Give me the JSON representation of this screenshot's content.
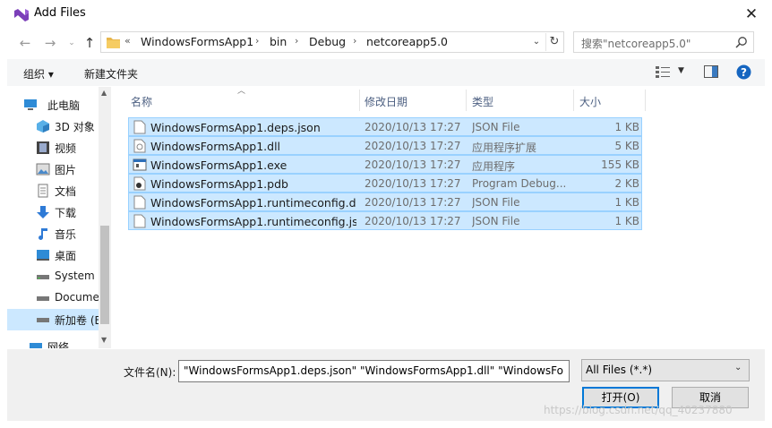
{
  "window": {
    "title": "Add Files"
  },
  "address": {
    "prefix": "«",
    "crumbs": [
      "WindowsFormsApp1",
      "bin",
      "Debug",
      "netcoreapp5.0"
    ]
  },
  "search": {
    "placeholder": "搜索\"netcoreapp5.0\""
  },
  "toolbar": {
    "organize_label": "组织 ▾",
    "new_folder_label": "新建文件夹"
  },
  "sidebar": {
    "items": [
      {
        "label": "此电脑",
        "icon": "computer-icon"
      },
      {
        "label": "3D 对象",
        "icon": "3d-objects-icon"
      },
      {
        "label": "视频",
        "icon": "video-icon"
      },
      {
        "label": "图片",
        "icon": "pictures-icon"
      },
      {
        "label": "文档",
        "icon": "documents-icon"
      },
      {
        "label": "下载",
        "icon": "download-icon"
      },
      {
        "label": "音乐",
        "icon": "music-icon"
      },
      {
        "label": "桌面",
        "icon": "desktop-icon"
      },
      {
        "label": "System (",
        "icon": "drive-icon"
      },
      {
        "label": "Docume",
        "icon": "drive-icon"
      },
      {
        "label": "新加卷 (E",
        "icon": "drive-icon"
      },
      {
        "label": "网络",
        "icon": "network-icon"
      }
    ]
  },
  "columns": {
    "name": "名称",
    "date": "修改日期",
    "type": "类型",
    "size": "大小"
  },
  "files": [
    {
      "name": "WindowsFormsApp1.deps.json",
      "date": "2020/10/13 17:27",
      "type": "JSON File",
      "size": "1 KB"
    },
    {
      "name": "WindowsFormsApp1.dll",
      "date": "2020/10/13 17:27",
      "type": "应用程序扩展",
      "size": "5 KB"
    },
    {
      "name": "WindowsFormsApp1.exe",
      "date": "2020/10/13 17:27",
      "type": "应用程序",
      "size": "155 KB"
    },
    {
      "name": "WindowsFormsApp1.pdb",
      "date": "2020/10/13 17:27",
      "type": "Program Debug...",
      "size": "2 KB"
    },
    {
      "name": "WindowsFormsApp1.runtimeconfig.d...",
      "date": "2020/10/13 17:27",
      "type": "JSON File",
      "size": "1 KB"
    },
    {
      "name": "WindowsFormsApp1.runtimeconfig.js...",
      "date": "2020/10/13 17:27",
      "type": "JSON File",
      "size": "1 KB"
    }
  ],
  "footer": {
    "filename_label": "文件名(N):",
    "filename_value": "\"WindowsFormsApp1.deps.json\" \"WindowsFormsApp1.dll\" \"WindowsFo",
    "filter_value": "All Files (*.*)",
    "open_label": "打开(O)",
    "cancel_label": "取消"
  },
  "watermark": "https://blog.csdn.net/qq_40237880",
  "colors": {
    "selection": "#cce8ff",
    "selection_border": "#99d1ff",
    "accent": "#0078d7"
  }
}
